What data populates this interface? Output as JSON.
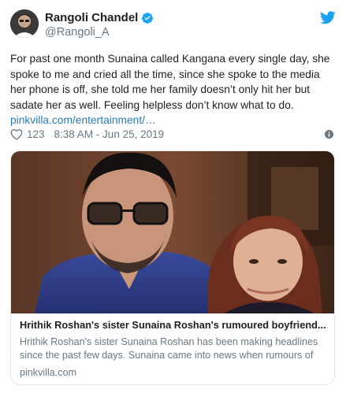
{
  "author": {
    "display_name": "Rangoli Chandel",
    "handle": "@Rangoli_A",
    "verified": true,
    "avatar_icon": "profile-photo"
  },
  "tweet": {
    "text": "For past one month Sunaina called Kangana every single day, she spoke to me and cried all the time, since she spoke to the media her phone is off, she told me her family doesn’t only hit her but sadate her as well. Feeling helpless don’t know what to do. ",
    "link_text": "pinkvilla.com/entertainment/…"
  },
  "meta": {
    "like_count": "123",
    "timestamp": "8:38 AM - Jun 25, 2019"
  },
  "card": {
    "title": "Hrithik Roshan's sister Sunaina Roshan's rumoured boyfriend...",
    "description": "Hrithik Roshan's sister Sunaina Roshan has been making headlines since the past few days. Sunaina came into news when rumours of",
    "domain": "pinkvilla.com"
  },
  "colors": {
    "twitter_blue": "#1da1f2",
    "link_blue": "#2b7bb9",
    "secondary_text": "#697882"
  }
}
